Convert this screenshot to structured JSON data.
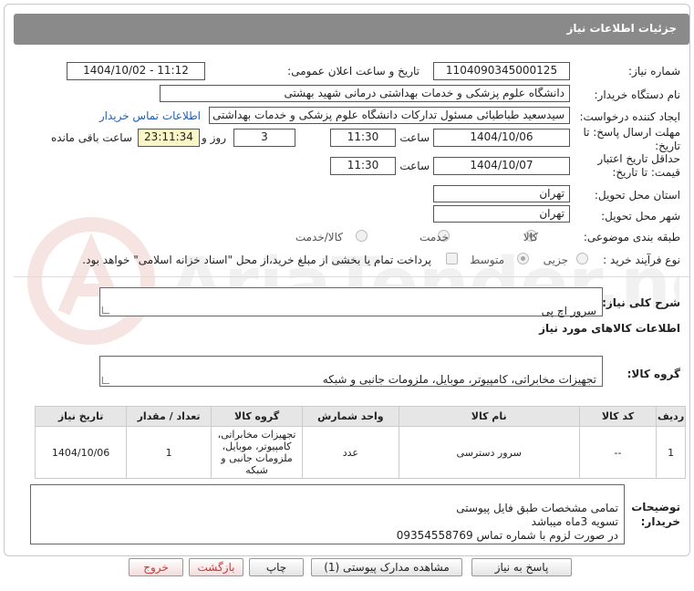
{
  "header": {
    "title": "جزئیات اطلاعات نیاز"
  },
  "fields": {
    "need_number_label": "شماره نیاز:",
    "need_number": "1104090345000125",
    "announce_label": "تاریخ و ساعت اعلان عمومی:",
    "announce_value": "1404/10/02 - 11:12",
    "buyer_org_label": "نام دستگاه خریدار:",
    "buyer_org": "دانشگاه علوم پزشکی و خدمات بهداشتی درمانی شهید بهشتی",
    "requester_label": "ایجاد کننده درخواست:",
    "requester": "سیدسعید طباطبائی مسئول تدارکات دانشگاه علوم پزشکی و خدمات بهداشتی",
    "contact_link": "اطلاعات تماس خریدار",
    "send_deadline_label_1": "مهلت ارسال پاسخ: تا",
    "send_deadline_label_2": "تاریخ:",
    "send_date": "1404/10/06",
    "time_label": "ساعت",
    "send_time": "11:30",
    "days": "3",
    "days_label": "روز و",
    "remaining": "23:11:34",
    "remaining_label": "ساعت باقی مانده",
    "price_validity_label_1": "حداقل تاریخ اعتبار",
    "price_validity_label_2": "قیمت: تا تاریخ:",
    "validity_date": "1404/10/07",
    "validity_time": "11:30",
    "province_label": "استان محل تحویل:",
    "province": "تهران",
    "city_label": "شهر محل تحویل:",
    "city": "تهران",
    "category_label": "طبقه بندی موضوعی:",
    "category_options": [
      "کالا",
      "خدمت",
      "کالا/خدمت"
    ],
    "process_label": "نوع فرآیند خرید :",
    "process_options": [
      "جزیی",
      "متوسط"
    ],
    "payment_note": "پرداخت تمام یا بخشی از مبلغ خرید،از محل \"اسناد خزانه اسلامی\" خواهد بود."
  },
  "summary": {
    "label": "شرح کلی نیاز:",
    "value": "سرور اچ پی"
  },
  "goods": {
    "section_title": "اطلاعات کالاهای مورد نیاز",
    "group_label": "گروه کالا:",
    "group_value": "تجهیزات مخابراتی، کامپیوتر، موبایل، ملزومات جانبی و شبکه"
  },
  "table": {
    "headers": [
      "ردیف",
      "کد کالا",
      "نام کالا",
      "واحد شمارش",
      "گروه کالا",
      "تعداد / مقدار",
      "تاریخ نیاز"
    ],
    "rows": [
      {
        "row": "1",
        "code": "--",
        "name": "سرور دسترسی",
        "unit": "عدد",
        "group": "تجهیزات مخابراتی، کامپیوتر، موبایل، ملزومات جانبی و شبکه",
        "qty": "1",
        "date": "1404/10/06"
      }
    ]
  },
  "notes": {
    "label_1": "توضیحات",
    "label_2": "خریدار:",
    "text": "تمامی مشخصات طبق فایل پیوستی\nتسویه 3ماه میباشد\nدر صورت لزوم با شماره تماس 09354558769"
  },
  "buttons": {
    "reply": "پاسخ به نیاز",
    "attachments": "مشاهده مدارک پیوستی (1)",
    "print": "چاپ",
    "back": "بازگشت",
    "exit": "خروج"
  },
  "colors": {
    "header_bg": "#8a8a8a",
    "link": "#1e5fb8",
    "remaining_bg": "#fbf6c7",
    "exit_text": "#c23a3a"
  }
}
